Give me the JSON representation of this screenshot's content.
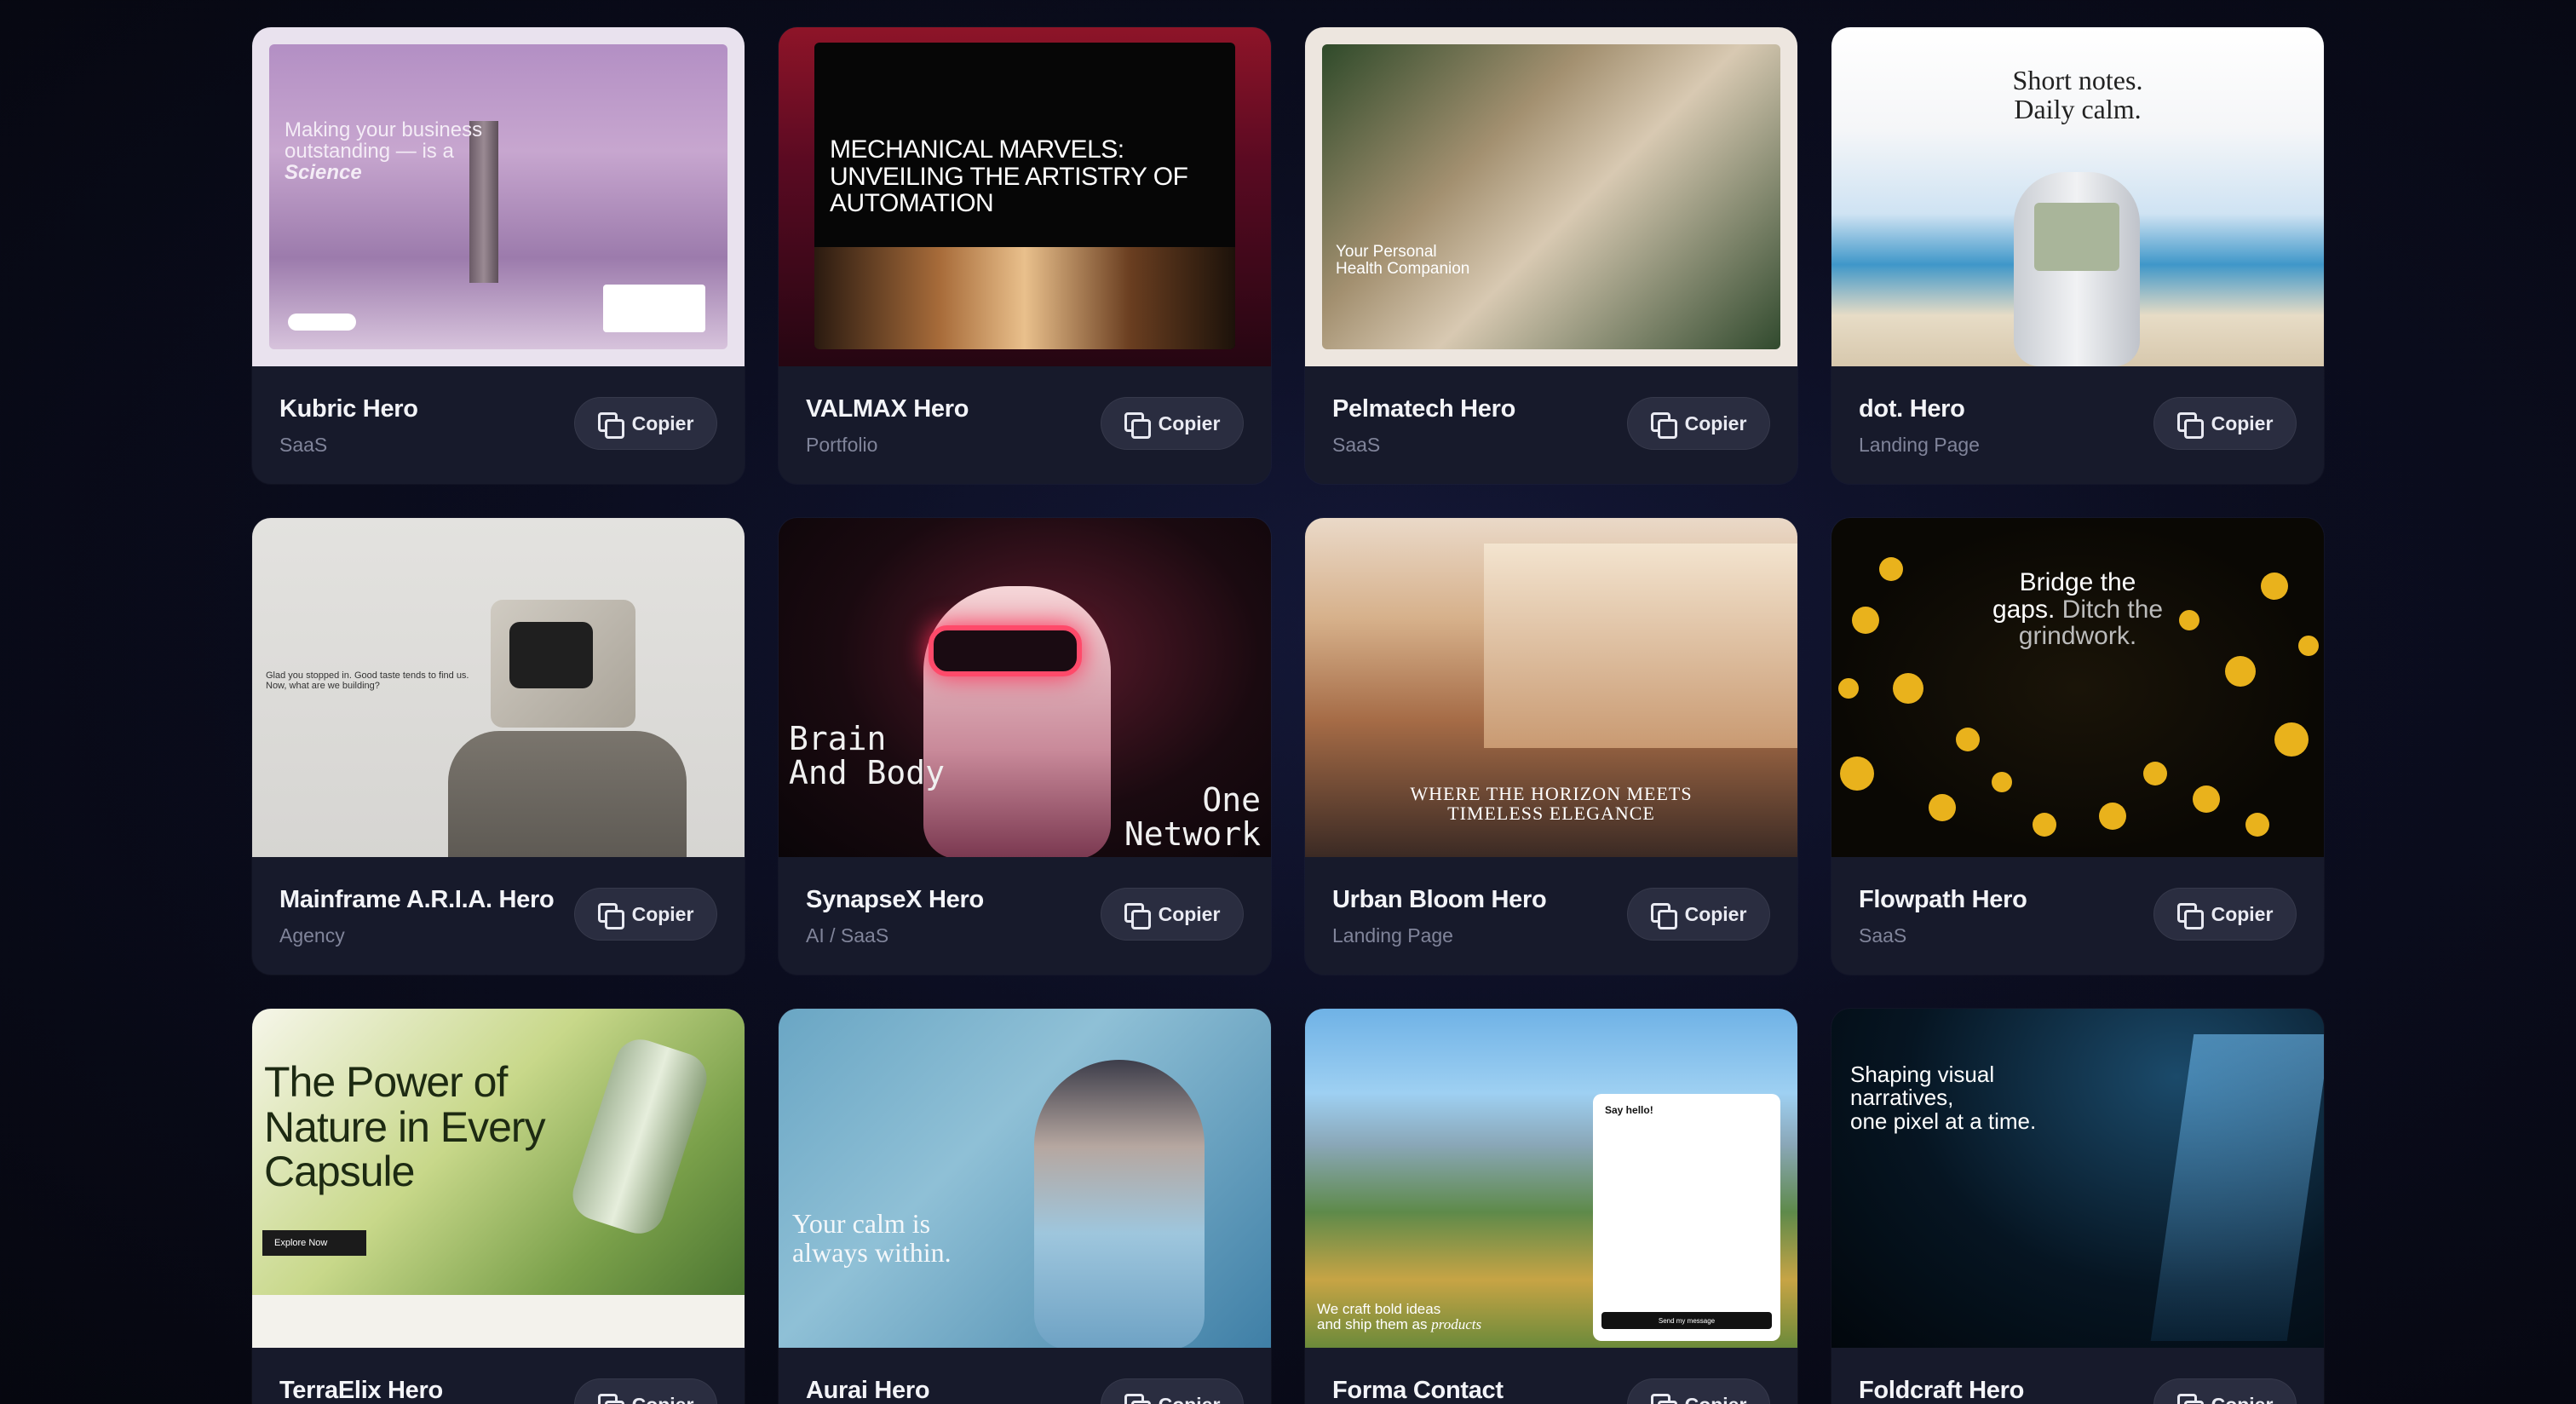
{
  "copy_label": "Copier",
  "cards": [
    {
      "title": "Kubric Hero",
      "category": "SaaS",
      "thumb_text": [
        "Making your business",
        "outstanding — is a",
        "Science"
      ]
    },
    {
      "title": "VALMAX Hero",
      "category": "Portfolio",
      "thumb_text": [
        "MECHANICAL MARVELS:",
        "UNVEILING THE ARTISTRY OF",
        "AUTOMATION"
      ]
    },
    {
      "title": "Pelmatech Hero",
      "category": "SaaS",
      "thumb_text": [
        "Your Personal",
        "Health Companion"
      ]
    },
    {
      "title": "dot. Hero",
      "category": "Landing Page",
      "thumb_text": [
        "Short notes.",
        "Daily calm."
      ]
    },
    {
      "title": "Mainframe A.R.I.A. Hero",
      "category": "Agency",
      "thumb_text": [
        "Glad you stopped in. Good taste tends to find us.",
        "Now, what are we building?"
      ]
    },
    {
      "title": "SynapseX Hero",
      "category": "AI / SaaS",
      "thumb_text": [
        "Brain",
        "And Body",
        "One",
        "Network"
      ]
    },
    {
      "title": "Urban Bloom Hero",
      "category": "Landing Page",
      "thumb_text": [
        "WHERE THE HORIZON MEETS",
        "TIMELESS ELEGANCE"
      ]
    },
    {
      "title": "Flowpath Hero",
      "category": "SaaS",
      "thumb_text": [
        "Bridge the",
        "gaps.",
        "Ditch the",
        "grindwork."
      ]
    },
    {
      "title": "TerraElix Hero",
      "category": "",
      "thumb_text": [
        "The Power of",
        "Nature in Every",
        "Capsule",
        "Explore Now"
      ]
    },
    {
      "title": "Aurai Hero",
      "category": "",
      "thumb_text": [
        "Your calm is",
        "always within."
      ]
    },
    {
      "title": "Forma Contact",
      "category": "",
      "thumb_text": [
        "Say hello!",
        "We craft bold ideas",
        "and ship them as",
        "products",
        "Send my message"
      ]
    },
    {
      "title": "Foldcraft Hero",
      "category": "",
      "thumb_text": [
        "Shaping visual",
        "narratives,",
        "one pixel at a time."
      ]
    }
  ]
}
